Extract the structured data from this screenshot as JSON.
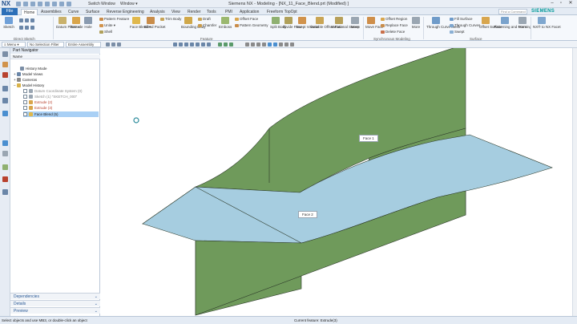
{
  "app": {
    "logo": "NX",
    "title": "Siemens NX - Modeling - [NX_11_Face_Blend.prt (Modified) ]",
    "switch_window": "Switch Window",
    "window_menu": "Window ▾",
    "siemens": "SIEMENS",
    "search_placeholder": "Find a Command"
  },
  "tabs": {
    "file": "File",
    "items": [
      "Home",
      "Assemblies",
      "Curve",
      "Surface",
      "Reverse Engineering",
      "Analysis",
      "View",
      "Render",
      "Tools",
      "PMI",
      "Application",
      "Freeform TopOpt"
    ],
    "active": "Home"
  },
  "ribbon": {
    "large": [
      {
        "label": "Sketch",
        "color": "#6fa0d8"
      },
      {
        "label": "Datum Plane ▾",
        "color": "#c9b16b"
      },
      {
        "label": "Extrude",
        "color": "#d9a54a"
      },
      {
        "label": "Hole",
        "color": "#8a9bb0"
      },
      {
        "label": "Face Blend ▾",
        "color": "#e0b84c"
      },
      {
        "label": "Blend Pocket",
        "color": "#c98d4a"
      },
      {
        "label": "Bounding Body",
        "color": "#d0a84a"
      },
      {
        "label": "Emboss",
        "color": "#9bb86f"
      },
      {
        "label": "Split Body",
        "color": "#8fb070"
      },
      {
        "label": "Divide Face",
        "color": "#b0a05a"
      },
      {
        "label": "Swept Volume",
        "color": "#d1934c"
      },
      {
        "label": "Variable Offset Face",
        "color": "#c9a555"
      },
      {
        "label": "Variational Sweep",
        "color": "#b7a05a"
      },
      {
        "label": "More",
        "color": "#9aa6b2"
      },
      {
        "label": "Move Face",
        "color": "#cf8f4a"
      },
      {
        "label": "More",
        "color": "#9aa6b2"
      },
      {
        "label": "Through Curve Mesh",
        "color": "#6f9bc9"
      },
      {
        "label": "Offset Surface",
        "color": "#d8a64e"
      },
      {
        "label": "Patterning and Forming",
        "color": "#7aa3cc"
      },
      {
        "label": "More",
        "color": "#9aa6b2"
      },
      {
        "label": "NX® to NX Facet",
        "color": "#7fa7cf"
      }
    ],
    "small": {
      "pattern_feature": "Pattern Feature",
      "unite": "Unite ▾",
      "shell": "Shell",
      "trim_body": "Trim Body",
      "draft": "Draft",
      "chamfer": "Chamfer",
      "offset_face": "Offset Face",
      "pattern_geometry": "Pattern Geometry",
      "offset_region": "Offset Region",
      "replace_face": "Replace Face",
      "delete_face": "Delete Face",
      "fill_surface": "Fill Surface",
      "through_curves": "Through Curves",
      "swept": "Swept"
    },
    "groups": {
      "direct_sketch": "Direct Sketch",
      "feature": "Feature",
      "synchronous": "Synchronous Modeling",
      "surface": "Surface"
    }
  },
  "toolbar": {
    "menu": "≡ Menu ▾",
    "filter": "No Selection Filter",
    "assembly": "Entire Assembly"
  },
  "navigator": {
    "title": "Part Navigator",
    "column": "Name",
    "nodes": [
      {
        "label": "History Mode",
        "style": "normal"
      },
      {
        "label": "Model Views",
        "style": "normal"
      },
      {
        "label": "Cameras",
        "style": "normal"
      },
      {
        "label": "Model History",
        "style": "normal"
      },
      {
        "label": "Datum Coordinate System (0)",
        "style": "gray"
      },
      {
        "label": "Sketch (1) \"SKETCH_000\"",
        "style": "gray"
      },
      {
        "label": "Extrude (2)",
        "style": "red"
      },
      {
        "label": "Extrude (3)",
        "style": "red"
      },
      {
        "label": "Face Blend (5)",
        "style": "sel"
      }
    ],
    "dependencies": "Dependencies",
    "details": "Details",
    "preview": "Preview"
  },
  "graphics": {
    "face1": "Face 1",
    "face2": "Face 2",
    "colors": {
      "green": "#6f9a5b",
      "blue": "#a6cde0",
      "edge": "#2d3a2a"
    }
  },
  "status": {
    "message": "Select objects and use MB3, or double-click an object",
    "feature": "Current feature: Extrude(3)"
  }
}
